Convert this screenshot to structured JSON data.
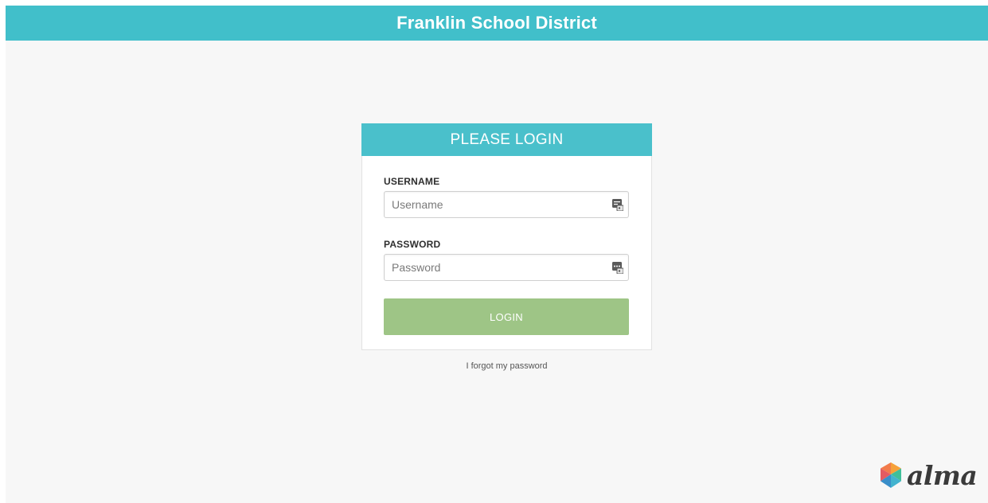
{
  "header": {
    "title": "Franklin School District",
    "bg_color": "#41bfca"
  },
  "login_card": {
    "heading": "PLEASE LOGIN",
    "username": {
      "label": "USERNAME",
      "placeholder": "Username",
      "value": "",
      "icon": "keychain-autofill-icon"
    },
    "password": {
      "label": "PASSWORD",
      "placeholder": "Password",
      "value": "",
      "icon": "keychain-autofill-icon"
    },
    "login_button": {
      "label": "LOGIN",
      "color": "#9ec586"
    }
  },
  "forgot_link": "I forgot my password",
  "brand": {
    "name": "alma",
    "icon": "alma-hexagon-logo-icon"
  }
}
